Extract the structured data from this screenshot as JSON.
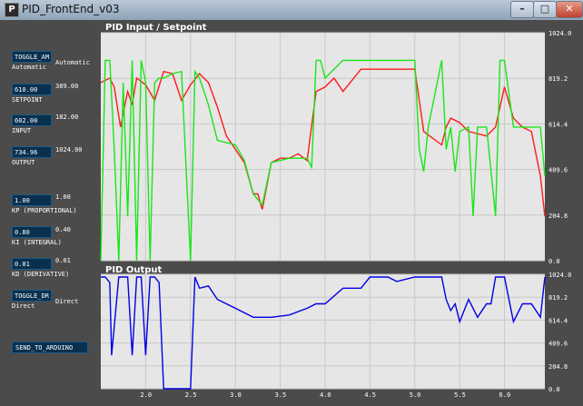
{
  "window": {
    "title": "PID_FrontEnd_v03",
    "icon": "P",
    "minimize": "–",
    "maximize": "□",
    "close": "✕"
  },
  "controls": {
    "mode_button": "TOGGLE_AM",
    "mode_value": "Automatic",
    "mode_label": "Automatic",
    "setpoint_value": "610.00",
    "setpoint_label": "SETPOINT",
    "setpoint_current": "389.00",
    "input_value": "602.00",
    "input_label": "INPUT",
    "input_current": "182.00",
    "output_value": "734.96",
    "output_label": "OUTPUT",
    "output_current": "1024.00",
    "kp_value": "1.00",
    "kp_label": "KP (PROPORTIONAL)",
    "kp_current": "1.00",
    "ki_value": "0.80",
    "ki_label": "KI (INTEGRAL)",
    "ki_current": "0.40",
    "kd_value": "0.01",
    "kd_label": "KD (DERIVATIVE)",
    "kd_current": "0.01",
    "dr_button": "TOGGLE_DR",
    "dr_value": "Direct",
    "dr_label": "Direct",
    "send_button": "SEND_TO_ARDUINO"
  },
  "chart_data": [
    {
      "type": "line",
      "title": "PID Input / Setpoint",
      "ylim": [
        0,
        1024
      ],
      "y_ticks": [
        "1024.0",
        "819.2",
        "614.4",
        "409.6",
        "204.8",
        "0.0"
      ],
      "series": [
        {
          "color": "#ff1a1a",
          "x": [
            1.5,
            1.6,
            1.65,
            1.72,
            1.8,
            1.85,
            1.9,
            2.0,
            2.1,
            2.2,
            2.3,
            2.4,
            2.5,
            2.6,
            2.7,
            2.8,
            2.9,
            3.0,
            3.1,
            3.2,
            3.25,
            3.3,
            3.4,
            3.5,
            3.6,
            3.7,
            3.8,
            3.9,
            4.0,
            4.1,
            4.2,
            4.4,
            4.6,
            4.7,
            4.8,
            4.9,
            5.0,
            5.1,
            5.3,
            5.35,
            5.4,
            5.5,
            5.6,
            5.8,
            5.9,
            6.0,
            6.1,
            6.2,
            6.3,
            6.4,
            6.45
          ],
          "y": [
            800,
            820,
            780,
            600,
            760,
            700,
            820,
            790,
            720,
            850,
            840,
            720,
            790,
            840,
            800,
            690,
            560,
            500,
            440,
            300,
            300,
            230,
            440,
            460,
            460,
            480,
            450,
            760,
            780,
            820,
            760,
            860,
            860,
            860,
            860,
            860,
            860,
            580,
            520,
            600,
            640,
            620,
            580,
            560,
            600,
            780,
            640,
            600,
            580,
            380,
            200
          ]
        },
        {
          "color": "#19e619",
          "x": [
            1.5,
            1.55,
            1.6,
            1.65,
            1.7,
            1.75,
            1.8,
            1.85,
            1.9,
            1.95,
            2.0,
            2.05,
            2.1,
            2.15,
            2.2,
            2.3,
            2.4,
            2.5,
            2.55,
            2.6,
            2.7,
            2.8,
            3.0,
            3.1,
            3.2,
            3.3,
            3.4,
            3.6,
            3.8,
            3.85,
            3.9,
            3.95,
            4.0,
            4.2,
            4.4,
            4.6,
            4.8,
            5.0,
            5.05,
            5.1,
            5.15,
            5.3,
            5.35,
            5.4,
            5.45,
            5.5,
            5.6,
            5.65,
            5.7,
            5.8,
            5.9,
            5.95,
            6.0,
            6.1,
            6.2,
            6.3,
            6.4,
            6.45
          ],
          "y": [
            0,
            900,
            900,
            500,
            0,
            800,
            200,
            900,
            0,
            900,
            800,
            0,
            800,
            820,
            820,
            840,
            850,
            0,
            850,
            820,
            700,
            540,
            520,
            450,
            300,
            250,
            440,
            460,
            460,
            420,
            900,
            900,
            820,
            900,
            900,
            900,
            900,
            900,
            500,
            400,
            600,
            900,
            500,
            600,
            400,
            580,
            600,
            200,
            600,
            600,
            200,
            900,
            900,
            600,
            600,
            600,
            600,
            380
          ]
        }
      ]
    },
    {
      "type": "line",
      "title": "PID Output",
      "ylim": [
        0,
        1024
      ],
      "y_ticks": [
        "1024.0",
        "819.2",
        "614.4",
        "409.6",
        "204.8",
        "0.0"
      ],
      "x_ticks": [
        "2.0",
        "2.5",
        "3.0",
        "3.5",
        "4.0",
        "4.5",
        "5.0",
        "5.5",
        "6.0"
      ],
      "series": [
        {
          "color": "#0000e6",
          "x": [
            1.5,
            1.55,
            1.6,
            1.62,
            1.7,
            1.75,
            1.8,
            1.85,
            1.9,
            1.95,
            2.0,
            2.05,
            2.1,
            2.15,
            2.2,
            2.3,
            2.4,
            2.5,
            2.55,
            2.6,
            2.7,
            2.8,
            3.0,
            3.2,
            3.4,
            3.6,
            3.8,
            3.9,
            4.0,
            4.2,
            4.4,
            4.5,
            4.6,
            4.7,
            4.8,
            5.0,
            5.2,
            5.3,
            5.35,
            5.4,
            5.45,
            5.5,
            5.6,
            5.7,
            5.8,
            5.85,
            5.9,
            6.0,
            6.1,
            6.2,
            6.3,
            6.4,
            6.45
          ],
          "y": [
            1000,
            1000,
            950,
            300,
            1000,
            1000,
            1000,
            300,
            1000,
            1000,
            300,
            1000,
            1000,
            950,
            0,
            0,
            0,
            0,
            1000,
            900,
            920,
            800,
            720,
            640,
            640,
            660,
            720,
            760,
            760,
            900,
            900,
            1000,
            1000,
            1000,
            960,
            1000,
            1000,
            1000,
            800,
            700,
            760,
            600,
            800,
            640,
            760,
            760,
            1000,
            1000,
            600,
            760,
            760,
            640,
            1000
          ]
        }
      ]
    }
  ]
}
